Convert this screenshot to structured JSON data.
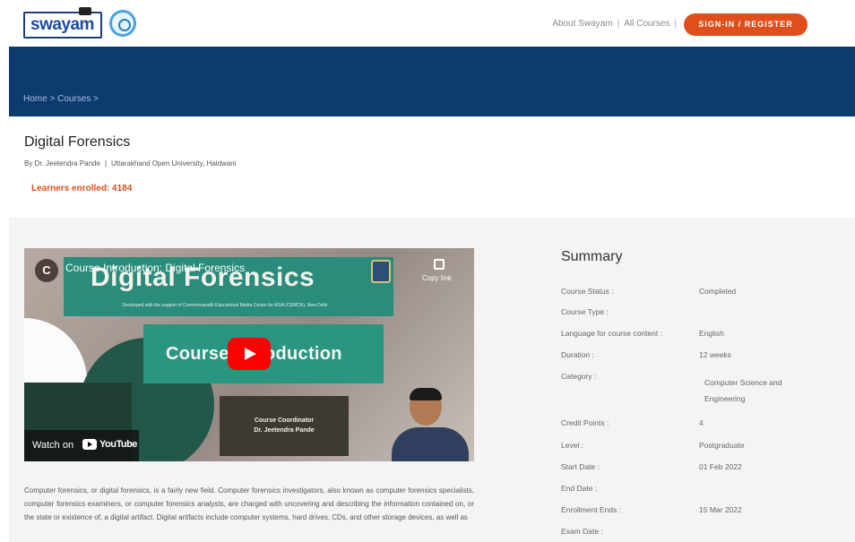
{
  "header": {
    "logo_text": "swayam",
    "links": [
      "About Swayam",
      "All Courses"
    ],
    "link_separator": "|",
    "signin_label": "SIGN-IN / REGISTER"
  },
  "breadcrumb": {
    "home": "Home",
    "courses": "Courses",
    "separator": ">"
  },
  "course": {
    "title": "Digital Forensics",
    "instructor": "By Dr. Jeetendra Pande",
    "institution": "Uttarakhand Open University, Haldwani",
    "separator": "|",
    "learners_enrolled": "Learners enrolled: 4184"
  },
  "video": {
    "channel_initial": "C",
    "youtube_title": "Course Introduction: Digital Forensics",
    "copy_link_label": "Copy link",
    "slide_title": "Digital Forensics",
    "slide_subtitle": "Developed with the support of Commonwealth Educational Media Centre for ASIA (CEMCA), New Delhi",
    "slide_intro": "Course Introduction",
    "coordinator_title": "Course Coordinator",
    "coordinator_name": "Dr. Jeetendra Pande",
    "watch_on": "Watch on",
    "youtube_wordmark": "YouTube"
  },
  "description": "Computer forensics, or digital forensics, is a fairly new field. Computer forensics investigators, also known as computer forensics specialists, computer forensics examiners, or computer forensics analysts, are charged with uncovering and describing the information contained on, or the state or existence of, a digital artifact. Digital artifacts include computer systems, hard drives, CDs, and other storage devices, as well as",
  "summary": {
    "title": "Summary",
    "rows": [
      {
        "label": "Course Status :",
        "value": "Completed"
      },
      {
        "label": "Course Type :",
        "value": ""
      },
      {
        "label": "Language for course content :",
        "value": "English"
      },
      {
        "label": "Duration :",
        "value": "12 weeks"
      },
      {
        "label": "Category :",
        "value": ""
      },
      {
        "label": "Credit Points :",
        "value": "4"
      },
      {
        "label": "Level :",
        "value": "Postgraduate"
      },
      {
        "label": "Start Date :",
        "value": "01 Feb 2022"
      },
      {
        "label": "End Date :",
        "value": ""
      },
      {
        "label": "Enrollment Ends :",
        "value": "15 Mar 2022"
      },
      {
        "label": "Exam Date :",
        "value": ""
      }
    ],
    "category_value": "Computer Science and Engineering"
  }
}
